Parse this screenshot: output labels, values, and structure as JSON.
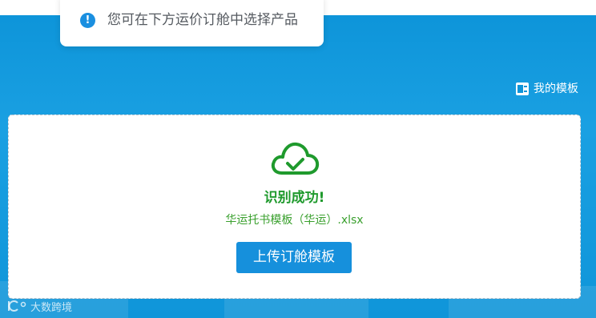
{
  "toast": {
    "icon": "info-icon",
    "icon_glyph": "!",
    "message": "您可在下方运价订舱中选择产品"
  },
  "template_link": {
    "icon": "excel-icon",
    "label": "我的模板"
  },
  "upload_card": {
    "icon": "cloud-check-icon",
    "status_title": "识别成功!",
    "file_name": "华运托书模板（华运）.xlsx",
    "upload_button_label": "上传订舱模板"
  },
  "watermark": {
    "logo": "brand-logo",
    "text": "大数跨境"
  },
  "colors": {
    "background": "#0f95d9",
    "success": "#1f9a2d",
    "primary_button": "#1690dc",
    "info_icon": "#1a8fe0"
  }
}
